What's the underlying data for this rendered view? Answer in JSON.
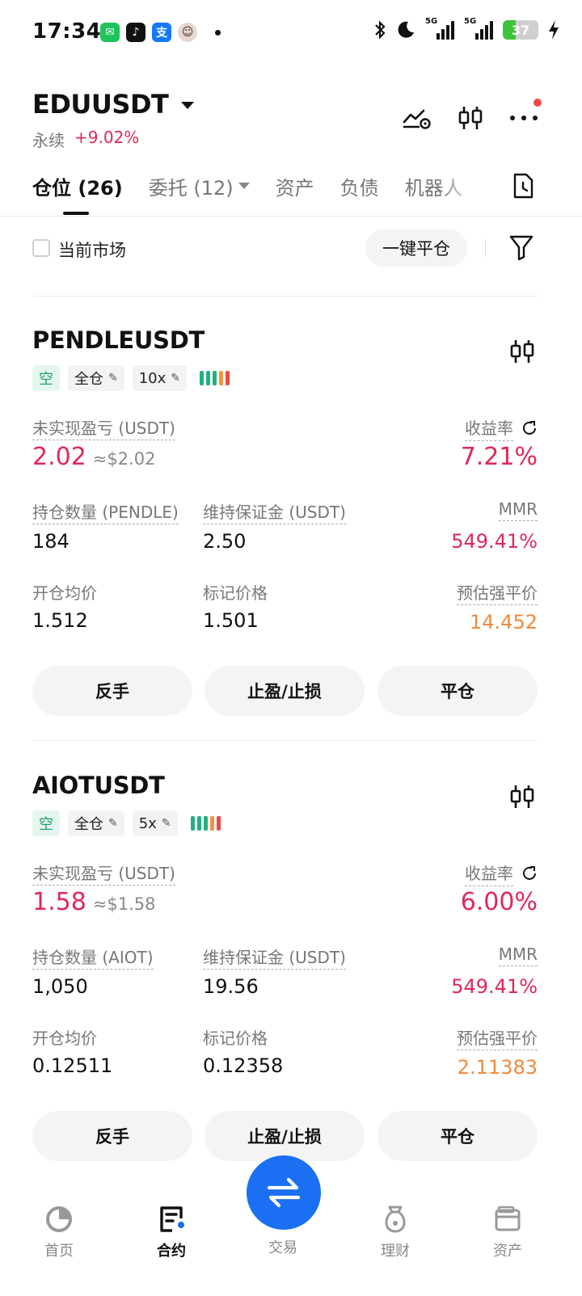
{
  "status_bar": {
    "time": "17:34",
    "network_label": "5G",
    "battery": "37",
    "battery_level": 0.37,
    "app_icons": [
      "wechat-icon",
      "tiktok-icon",
      "alipay-icon",
      "avatar-icon"
    ],
    "right_icons": [
      "bluetooth-icon",
      "moon-icon",
      "signal-icon",
      "signal-icon",
      "battery-icon",
      "charging-icon"
    ]
  },
  "header": {
    "symbol": "EDUUSDT",
    "contract_type": "永续",
    "change": "+9.02%",
    "icons": [
      "price-alert-icon",
      "candlestick-chart-icon",
      "more-icon"
    ]
  },
  "tabs": [
    {
      "label": "仓位 (26)",
      "active": true
    },
    {
      "label": "委托 (12)",
      "active": false,
      "dropdown": true
    },
    {
      "label": "资产",
      "active": false
    },
    {
      "label": "负债",
      "active": false
    },
    {
      "label": "机器人",
      "active": false
    }
  ],
  "filter": {
    "current_market_label": "当前市场",
    "close_all_label": "一键平仓"
  },
  "labels": {
    "unrealized_pnl": "未实现盈亏 (USDT)",
    "roe": "收益率",
    "maintenance_margin": "维持保证金 (USDT)",
    "mmr": "MMR",
    "entry_price": "开仓均价",
    "mark_price": "标记价格",
    "liq_price": "预估强平价",
    "reverse": "反手",
    "tp_sl": "止盈/止损",
    "close": "平仓"
  },
  "positions": [
    {
      "symbol": "PENDLEUSDT",
      "side": "空",
      "margin_mode": "全仓",
      "leverage": "10x",
      "pnl": "2.02",
      "pnl_usd": "≈$2.02",
      "roe": "7.21%",
      "size_label": "持仓数量 (PENDLE)",
      "size": "184",
      "maint_margin": "2.50",
      "mmr": "549.41%",
      "entry_price": "1.512",
      "mark_price": "1.501",
      "liq_price": "14.452"
    },
    {
      "symbol": "AIOTUSDT",
      "side": "空",
      "margin_mode": "全仓",
      "leverage": "5x",
      "pnl": "1.58",
      "pnl_usd": "≈$1.58",
      "roe": "6.00%",
      "size_label": "持仓数量 (AIOT)",
      "size": "1,050",
      "maint_margin": "19.56",
      "mmr": "549.41%",
      "entry_price": "0.12511",
      "mark_price": "0.12358",
      "liq_price": "2.11383"
    }
  ],
  "adl_colors": [
    "#22b07d",
    "#22b07d",
    "#22b07d",
    "#f0943c",
    "#ee4b4b"
  ],
  "bottom_nav": [
    {
      "label": "首页",
      "icon": "home-icon",
      "active": false
    },
    {
      "label": "合约",
      "icon": "contract-icon",
      "active": true
    },
    {
      "label": "交易",
      "icon": "trade-swap-icon",
      "active": false
    },
    {
      "label": "理财",
      "icon": "earn-icon",
      "active": false
    },
    {
      "label": "资产",
      "icon": "wallet-icon",
      "active": false
    }
  ],
  "colors": {
    "accent_blue": "#1a6ff2",
    "red": "#e0285a",
    "orange": "#f08a3c",
    "green": "#22a06b"
  }
}
